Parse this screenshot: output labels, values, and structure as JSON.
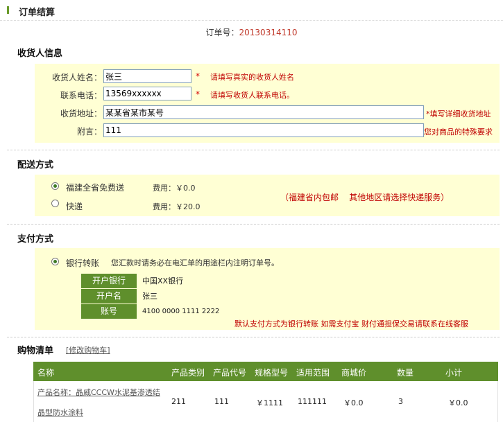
{
  "header": {
    "title": "订单结算"
  },
  "order": {
    "label": "订单号：",
    "number": "20130314110"
  },
  "recipient": {
    "title": "收货人信息",
    "fields": [
      {
        "label": "收货人姓名：",
        "value": "张三",
        "required": "*",
        "hint": "请填写真实的收货人姓名"
      },
      {
        "label": "联系电话：",
        "value": "13569xxxxxx",
        "required": "*",
        "hint": "请填写收货人联系电话。"
      },
      {
        "label": "收货地址：",
        "value": "某某省某市某号",
        "hint": "*填写详细收货地址"
      },
      {
        "label": "附言：",
        "value": "111",
        "hint": "您对商品的特殊要求"
      }
    ]
  },
  "delivery": {
    "title": "配送方式",
    "options": [
      {
        "label": "福建全省免费送",
        "fee": "费用：￥0.0",
        "selected": true
      },
      {
        "label": "快递",
        "fee": "费用：￥20.0",
        "selected": false
      }
    ],
    "note": "（福建省内包邮    其他地区请选择快递服务）"
  },
  "payment": {
    "title": "支付方式",
    "option": {
      "label": "银行转账",
      "selected": true
    },
    "instruction": "您汇款时请务必在电汇单的用途栏内注明订单号。",
    "bank": [
      {
        "label": "开户银行",
        "value": "中国XX银行"
      },
      {
        "label": "开户名",
        "value": "张三"
      },
      {
        "label": "账号",
        "value": "4100 0000 1111 2222"
      }
    ],
    "note": "默认支付方式为银行转账 如需支付宝 财付通担保交易请联系在线客服"
  },
  "cart": {
    "title": "购物清单",
    "modify_link": "[修改购物车]",
    "columns": [
      "名称",
      "产品类别",
      "产品代号",
      "规格型号",
      "适用范围",
      "商城价",
      "数量",
      "小计"
    ],
    "rows": [
      {
        "name_line1": "产品名称：晶威CCCW水泥基渗透结",
        "name_line2": "晶型防水涂料",
        "category": "211",
        "code": "111",
        "model": "￥1111",
        "scope": "111111",
        "price": "￥0.0",
        "qty": "3",
        "subtotal": "￥0.0"
      }
    ]
  },
  "colors": {
    "accent_green": "#6a9a2a",
    "table_header": "#5f8f2c",
    "panel_yellow": "#ffffd4",
    "alert_red": "#c00000"
  }
}
